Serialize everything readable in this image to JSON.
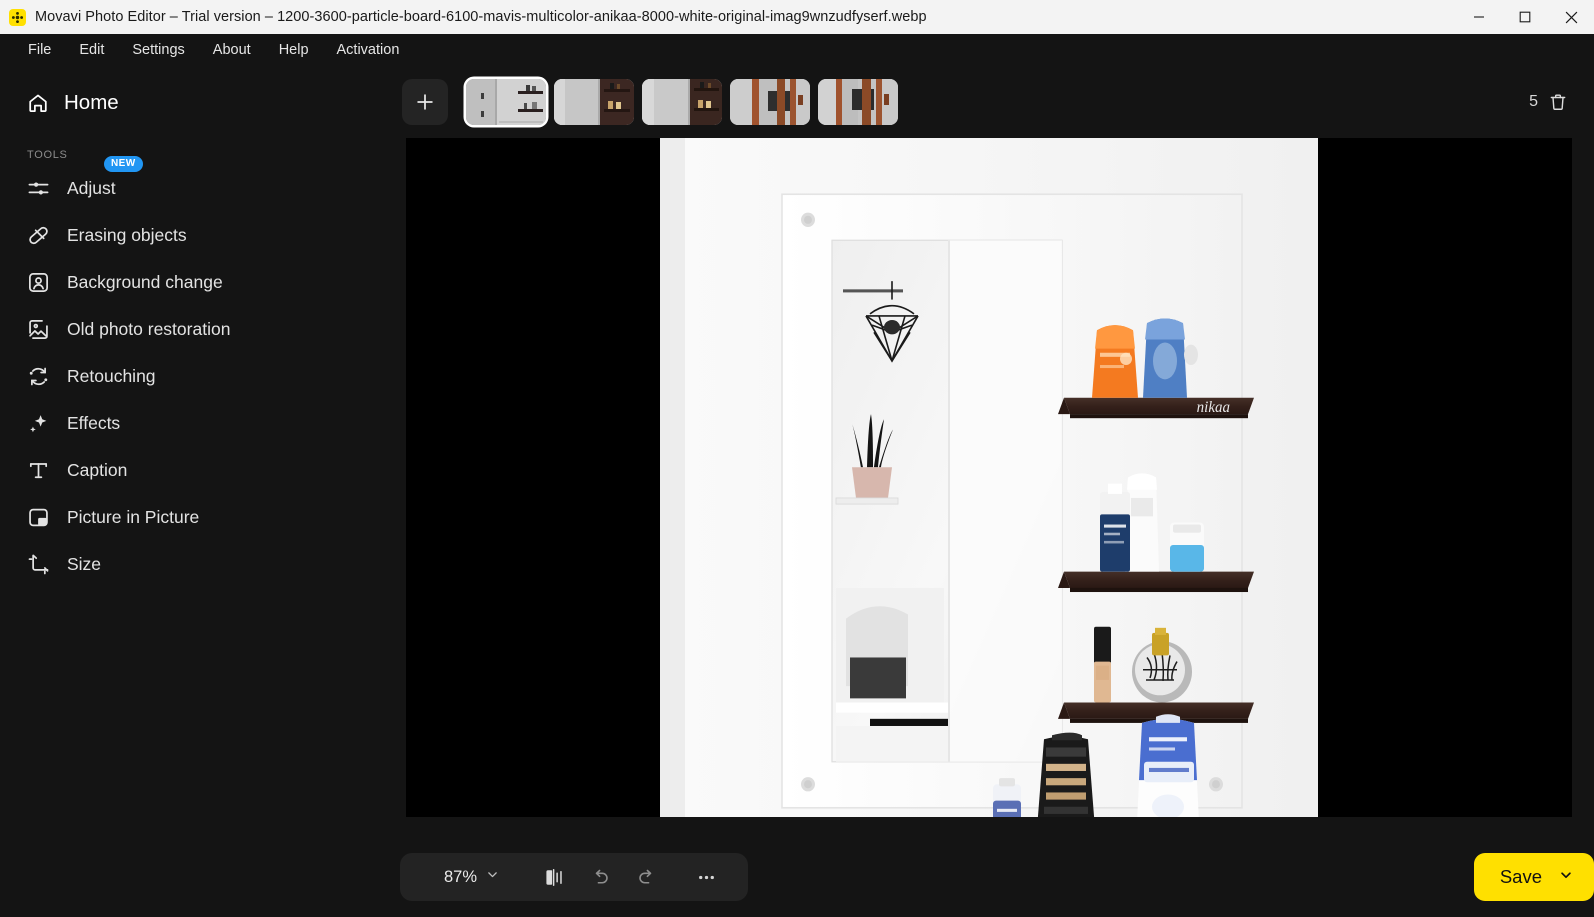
{
  "window": {
    "title": "Movavi Photo Editor – Trial version – 1200-3600-particle-board-6100-mavis-multicolor-anikaa-8000-white-original-imag9wnzudfyserf.webp",
    "app_icon": "movavi-logo-icon",
    "controls": {
      "minimize": "minimize-icon",
      "maximize": "maximize-icon",
      "close": "close-icon"
    }
  },
  "menubar": {
    "items": [
      {
        "label": "File"
      },
      {
        "label": "Edit"
      },
      {
        "label": "Settings"
      },
      {
        "label": "About"
      },
      {
        "label": "Help"
      },
      {
        "label": "Activation"
      }
    ]
  },
  "sidebar": {
    "home": {
      "label": "Home",
      "icon": "home-icon"
    },
    "section_label": "TOOLS",
    "tools": [
      {
        "label": "Adjust",
        "icon": "sliders-icon",
        "badge": "NEW"
      },
      {
        "label": "Erasing objects",
        "icon": "eraser-icon",
        "badge": ""
      },
      {
        "label": "Background change",
        "icon": "portrait-icon",
        "badge": ""
      },
      {
        "label": "Old photo restoration",
        "icon": "photo-restore-icon",
        "badge": ""
      },
      {
        "label": "Retouching",
        "icon": "retouch-icon",
        "badge": ""
      },
      {
        "label": "Effects",
        "icon": "sparkle-icon",
        "badge": ""
      },
      {
        "label": "Caption",
        "icon": "text-t-icon",
        "badge": ""
      },
      {
        "label": "Picture in Picture",
        "icon": "picture-in-picture-icon",
        "badge": ""
      },
      {
        "label": "Size",
        "icon": "crop-icon",
        "badge": ""
      }
    ]
  },
  "thumbstrip": {
    "add_button": {
      "icon": "plus-icon",
      "label": "+"
    },
    "thumbnails": [
      {
        "name": "thumb-1",
        "selected": true
      },
      {
        "name": "thumb-2",
        "selected": false
      },
      {
        "name": "thumb-3",
        "selected": false
      },
      {
        "name": "thumb-4",
        "selected": false
      },
      {
        "name": "thumb-5",
        "selected": false
      }
    ],
    "image_count": "5",
    "delete_icon": "trash-icon"
  },
  "canvas": {
    "letterbox_color": "#000000",
    "photo_description": "White wall-mounted bathroom shelf unit with mirror and dark wood shelves holding cosmetic bottles and tubes",
    "watermark": "nikaa"
  },
  "bottombar": {
    "zoom": {
      "value": "87%",
      "chevron": "chevron-down-icon"
    },
    "compare": {
      "icon": "compare-before-after-icon"
    },
    "undo": {
      "icon": "undo-icon"
    },
    "redo": {
      "icon": "redo-icon"
    },
    "more": {
      "icon": "more-horizontal-icon"
    },
    "save": {
      "label": "Save",
      "chevron": "chevron-down-icon",
      "color": "#ffe000"
    }
  },
  "colors": {
    "app_background": "#141414",
    "titlebar": "#f3f3f3",
    "accent_yellow": "#ffe000",
    "badge_blue": "#2196f3",
    "canvas_black": "#000000"
  }
}
